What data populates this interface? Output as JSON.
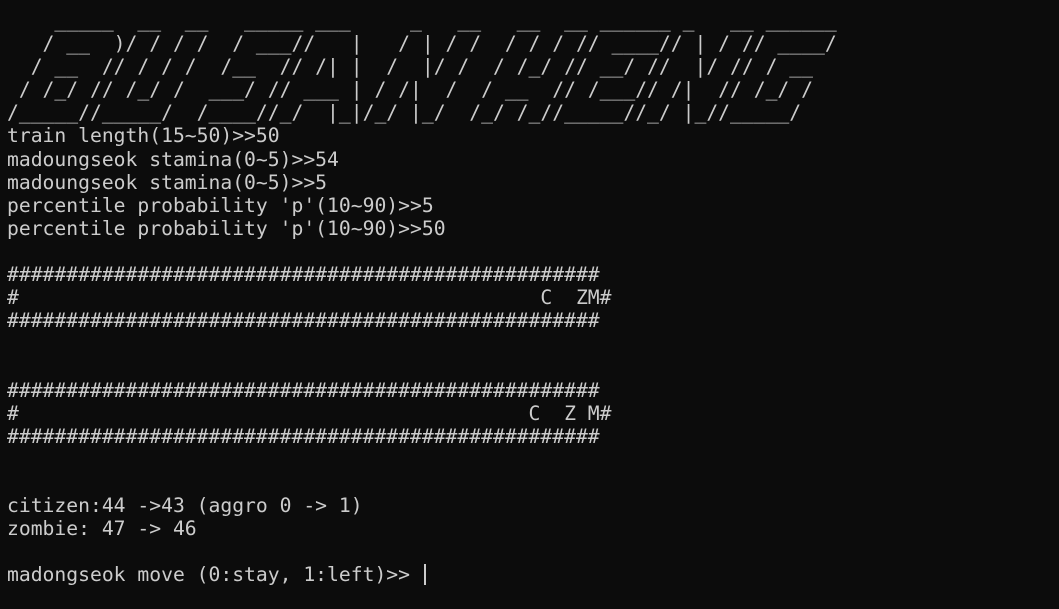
{
  "theme": {
    "background": "#0c0c0c",
    "foreground": "#cccccc"
  },
  "banner": [
    "    _____  __  __   _____ ___     _   __   __  __ ______ _   __ ______",
    "   / __  )/ / / /  / ___//   |   / | / /  / / / // ____// | / // ____/",
    "  / __  // / / /  /__  // /| |  /  |/ /  / /_/ // __/ //  |/ // / __  ",
    " / /_/ // /_/ /  ___/ // ___ | / /|  /  / __  // /___// /|  // /_/ /  ",
    "/_____//_____/  /____//_/  |_|/_/ |_/  /_/ /_//_____//_/ |_//_____/   "
  ],
  "setup": {
    "train_length": "train length(15~50)>>50",
    "stamina_invalid": "madoungseok stamina(0~5)>>54",
    "stamina_valid": "madoungseok stamina(0~5)>>5",
    "prob_invalid": "percentile probability 'p'(10~90)>>5",
    "prob_valid": "percentile probability 'p'(10~90)>>50"
  },
  "train_1": {
    "top": "##################################################",
    "middle": "#                                            C  ZM#",
    "bottom": "##################################################"
  },
  "train_2": {
    "top": "##################################################",
    "middle": "#                                           C  Z M#",
    "bottom": "##################################################"
  },
  "status": {
    "citizen": "citizen:44 ->43 (aggro 0 -> 1)",
    "zombie": "zombie: 47 -> 46"
  },
  "prompt": {
    "text": "madongseok move (0:stay, 1:left)>> ",
    "input_value": ""
  }
}
